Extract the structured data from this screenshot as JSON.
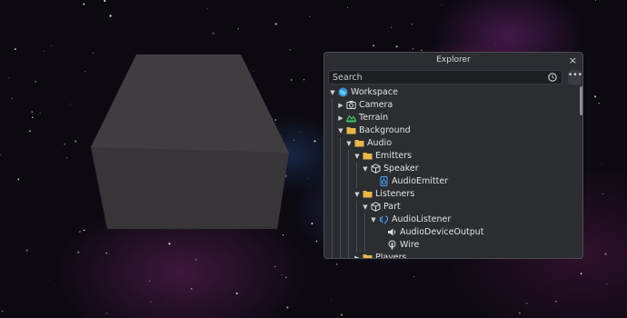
{
  "explorer": {
    "title": "Explorer",
    "search_placeholder": "Search",
    "more_label": "•••",
    "close_label": "×"
  },
  "tree": [
    {
      "label": "Workspace",
      "icon": "globe-icon"
    },
    {
      "label": "Camera",
      "icon": "camera-icon"
    },
    {
      "label": "Terrain",
      "icon": "terrain-icon"
    },
    {
      "label": "Background",
      "icon": "folder-icon"
    },
    {
      "label": "Audio",
      "icon": "folder-icon"
    },
    {
      "label": "Emitters",
      "icon": "folder-icon"
    },
    {
      "label": "Speaker",
      "icon": "part-cube-icon"
    },
    {
      "label": "AudioEmitter",
      "icon": "audio-emitter-icon"
    },
    {
      "label": "Listeners",
      "icon": "folder-icon"
    },
    {
      "label": "Part",
      "icon": "part-cube-icon"
    },
    {
      "label": "AudioListener",
      "icon": "audio-listener-icon"
    },
    {
      "label": "AudioDeviceOutput",
      "icon": "speaker-icon"
    },
    {
      "label": "Wire",
      "icon": "wire-icon"
    },
    {
      "label": "Players",
      "icon": "folder-icon"
    }
  ],
  "colors": {
    "panel": "#2b2d31",
    "folder": "#e6b84a",
    "accent": "#4aa3ff",
    "terrain": "#3fbf5f"
  }
}
